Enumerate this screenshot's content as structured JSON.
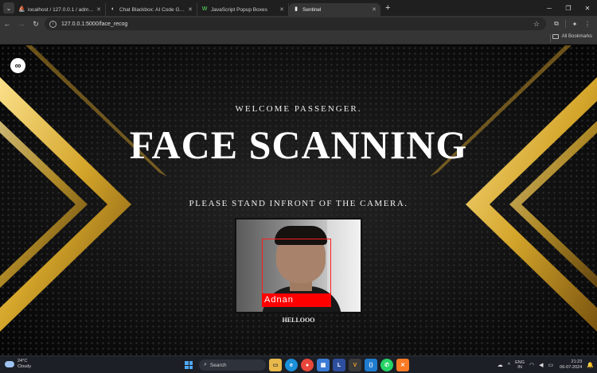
{
  "browser": {
    "tabs": [
      {
        "favicon": "⛵",
        "title": "localhost / 127.0.0.1 / admin_db /",
        "active": false
      },
      {
        "favicon": "◐",
        "title": "Chat Blackbox: AI Code Generatio",
        "active": false
      },
      {
        "favicon": "W",
        "title": "JavaScript Popup Boxes",
        "active": false
      },
      {
        "favicon": "▮",
        "title": "Sentinel",
        "active": true
      }
    ],
    "url": "127.0.0.1:5000/face_recog",
    "all_bookmarks": "All Bookmarks"
  },
  "page": {
    "logo_icon": "∞",
    "welcome": "WELCOME PASSENGER.",
    "heading": "FACE SCANNING",
    "instruction": "PLEASE STAND INFRONT OF THE CAMERA.",
    "recognized_name": "Adnan",
    "caption": "HELLOOO",
    "accent_gold": "#d4a52a",
    "box_color": "#ff0000"
  },
  "taskbar": {
    "weather_temp": "24°C",
    "weather_desc": "Cloudy",
    "search": "Search",
    "lang_1": "ENG",
    "lang_2": "IN",
    "time": "21:23",
    "date": "06-07-2024",
    "apps": [
      "file-explorer-icon",
      "edge-icon",
      "chrome-icon",
      "store-icon",
      "l-app-icon",
      "v-app-icon",
      "vscode-icon",
      "whatsapp-icon",
      "xampp-icon"
    ]
  }
}
